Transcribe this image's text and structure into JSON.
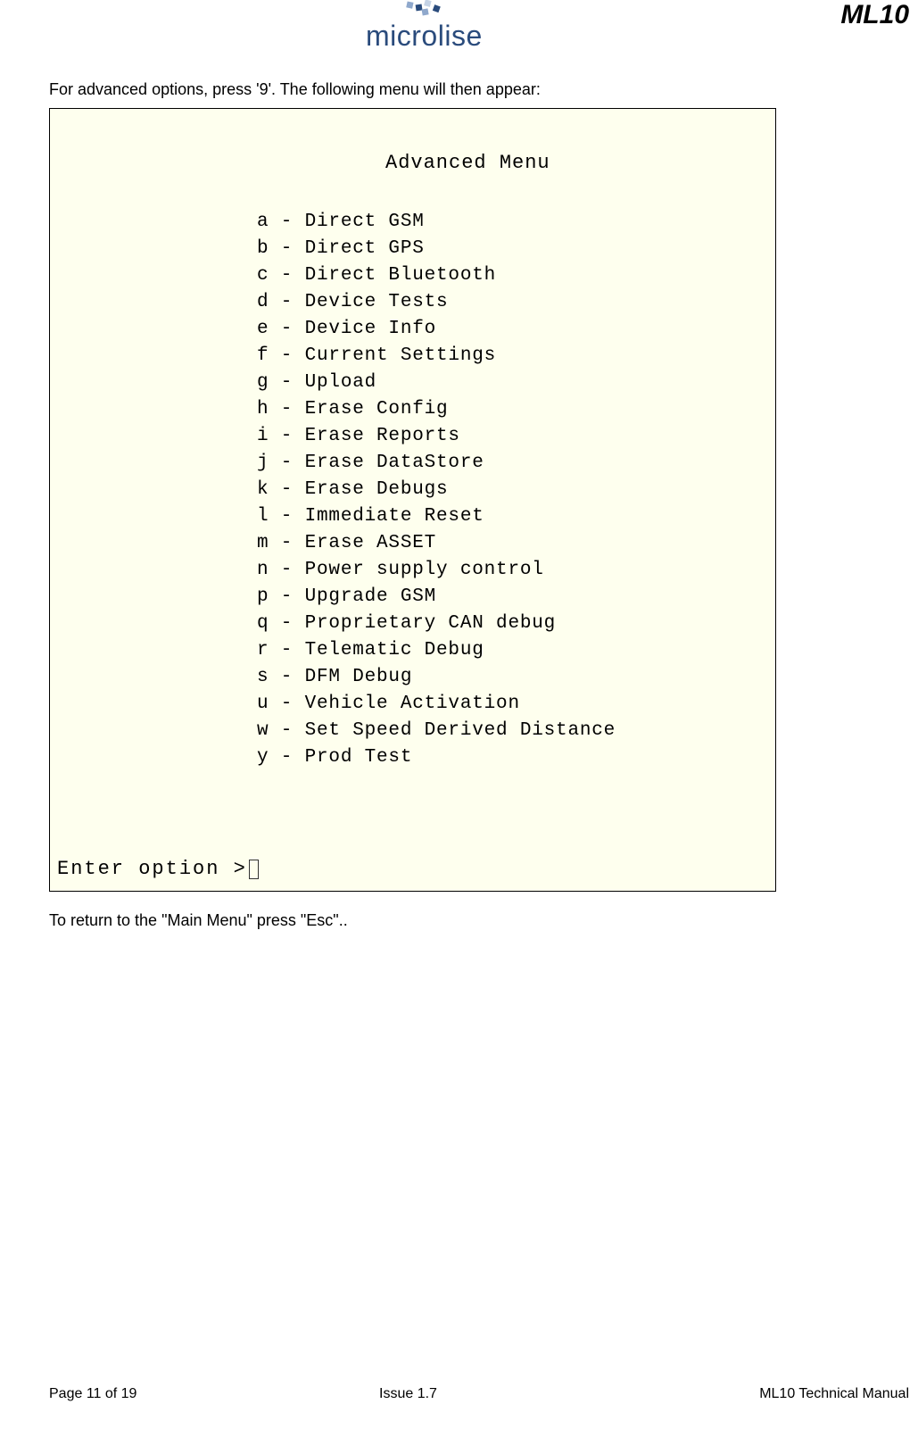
{
  "header": {
    "logo_text": "microlise",
    "doc_code": "ML10"
  },
  "content": {
    "intro": "For advanced options, press '9'. The following menu will then appear:",
    "terminal": {
      "title": "Advanced Menu",
      "items": [
        {
          "key": "a",
          "label": "Direct GSM"
        },
        {
          "key": "b",
          "label": "Direct GPS"
        },
        {
          "key": "c",
          "label": "Direct Bluetooth"
        },
        {
          "key": "d",
          "label": "Device Tests"
        },
        {
          "key": "e",
          "label": "Device Info"
        },
        {
          "key": "f",
          "label": "Current Settings"
        },
        {
          "key": "g",
          "label": "Upload"
        },
        {
          "key": "h",
          "label": "Erase Config"
        },
        {
          "key": "i",
          "label": "Erase Reports"
        },
        {
          "key": "j",
          "label": "Erase DataStore"
        },
        {
          "key": "k",
          "label": "Erase Debugs"
        },
        {
          "key": "l",
          "label": "Immediate Reset"
        },
        {
          "key": "m",
          "label": "Erase ASSET"
        },
        {
          "key": "n",
          "label": "Power supply control"
        },
        {
          "key": "p",
          "label": "Upgrade GSM"
        },
        {
          "key": "q",
          "label": "Proprietary CAN debug"
        },
        {
          "key": "r",
          "label": "Telematic Debug"
        },
        {
          "key": "s",
          "label": "DFM Debug"
        },
        {
          "key": "u",
          "label": "Vehicle Activation"
        },
        {
          "key": "w",
          "label": "Set Speed Derived Distance"
        },
        {
          "key": "y",
          "label": "Prod Test"
        }
      ],
      "prompt": "Enter option >"
    },
    "outro": "To return to the \"Main Menu\" press \"Esc\".."
  },
  "footer": {
    "left": "Page 11 of 19",
    "center": "Issue 1.7",
    "right": "ML10 Technical Manual"
  }
}
